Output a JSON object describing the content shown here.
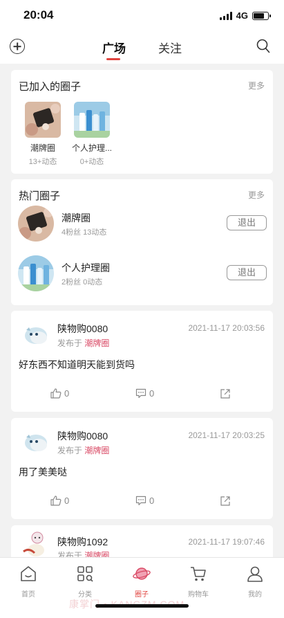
{
  "status": {
    "time": "20:04",
    "network": "4G"
  },
  "nav": {
    "tabs": [
      {
        "label": "广场"
      },
      {
        "label": "关注"
      }
    ]
  },
  "joined": {
    "title": "已加入的圈子",
    "more": "更多",
    "items": [
      {
        "name": "潮牌圈",
        "count": "13+动态"
      },
      {
        "name": "个人护理...",
        "count": "0+动态"
      }
    ]
  },
  "hot": {
    "title": "热门圈子",
    "more": "更多",
    "items": [
      {
        "name": "潮牌圈",
        "stats": "4粉丝 13动态",
        "button": "退出"
      },
      {
        "name": "个人护理圈",
        "stats": "2粉丝 0动态",
        "button": "退出"
      }
    ]
  },
  "posts": [
    {
      "user": "陕物购0080",
      "published_prefix": "发布于",
      "circle": "潮牌圈",
      "time": "2021-11-17 20:03:56",
      "text": "好东西不知道明天能到货吗",
      "likes": "0",
      "comments": "0"
    },
    {
      "user": "陕物购0080",
      "published_prefix": "发布于",
      "circle": "潮牌圈",
      "time": "2021-11-17 20:03:25",
      "text": "用了美美哒",
      "likes": "0",
      "comments": "0"
    },
    {
      "user": "陕物购1092",
      "published_prefix": "发布于",
      "circle": "潮牌圈",
      "time": "2021-11-17 19:07:46"
    }
  ],
  "tabbar": {
    "items": [
      {
        "label": "首页"
      },
      {
        "label": "分类"
      },
      {
        "label": "圈子"
      },
      {
        "label": "购物车"
      },
      {
        "label": "我的"
      }
    ]
  },
  "watermark": "康掌门 • KANGZM.COM",
  "colors": {
    "accent": "#e0443f",
    "circle_link": "#d94a65",
    "background": "#f2f2f2"
  }
}
